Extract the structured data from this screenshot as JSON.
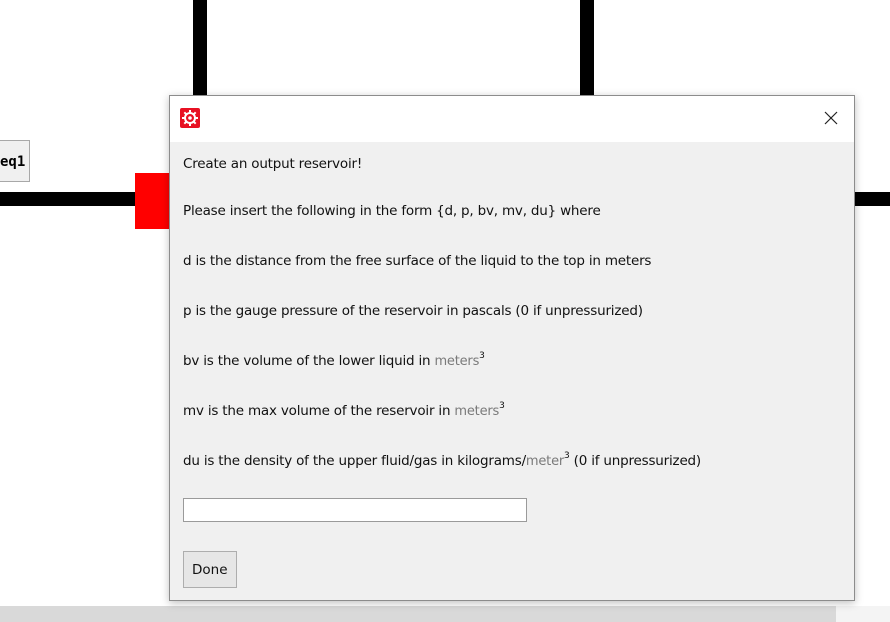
{
  "canvas": {
    "node_label": "eq1"
  },
  "dialog": {
    "close_symbol": "✕",
    "lines": {
      "title": "Create an output reservoir!",
      "instruction": "Please insert the following in the form {d, p, bv, mv, du} where",
      "d_desc": "d is the distance from the free surface of the liquid to the top in meters",
      "p_desc": "p is the gauge pressure of the reservoir in pascals (0 if unpressurized)",
      "bv_desc": "bv is the volume of the lower liquid in ",
      "bv_unit": "meters",
      "bv_exp": "3",
      "mv_desc": "mv is the max volume of the reservoir in ",
      "mv_unit": "meters",
      "mv_exp": "3",
      "du_desc": "du is the density of the upper fluid/gas in kilograms/",
      "du_unit": "meter",
      "du_exp": "3",
      "du_suffix": " (0 if unpressurized)"
    },
    "input": {
      "value": "",
      "placeholder": ""
    },
    "done_label": "Done"
  },
  "colors": {
    "accent_red": "#ff0000",
    "icon_red": "#e81123"
  },
  "icons": {
    "app": "java-gear-icon",
    "close": "close-icon"
  }
}
